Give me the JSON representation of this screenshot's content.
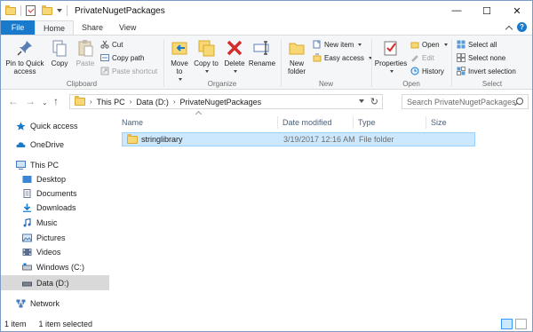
{
  "window": {
    "title": "PrivateNugetPackages",
    "controls": {
      "minimize": "—",
      "maximize": "☐",
      "close": "✕"
    }
  },
  "tabs": [
    "File",
    "Home",
    "Share",
    "View"
  ],
  "ribbon": {
    "clipboard": {
      "label": "Clipboard",
      "pin": "Pin to Quick access",
      "copy": "Copy",
      "paste": "Paste",
      "cut": "Cut",
      "copy_path": "Copy path",
      "paste_shortcut": "Paste shortcut"
    },
    "organize": {
      "label": "Organize",
      "move_to": "Move to",
      "copy_to": "Copy to",
      "delete": "Delete",
      "rename": "Rename"
    },
    "new": {
      "label": "New",
      "new_folder": "New folder",
      "new_item": "New item",
      "easy_access": "Easy access"
    },
    "open": {
      "label": "Open",
      "properties": "Properties",
      "open": "Open",
      "edit": "Edit",
      "history": "History"
    },
    "select": {
      "label": "Select",
      "select_all": "Select all",
      "select_none": "Select none",
      "invert": "Invert selection"
    }
  },
  "address": {
    "crumbs": [
      "This PC",
      "Data (D:)",
      "PrivateNugetPackages"
    ],
    "search_placeholder": "Search PrivateNugetPackages"
  },
  "nav": {
    "quick_access": "Quick access",
    "onedrive": "OneDrive",
    "this_pc": "This PC",
    "desktop": "Desktop",
    "documents": "Documents",
    "downloads": "Downloads",
    "music": "Music",
    "pictures": "Pictures",
    "videos": "Videos",
    "windows_c": "Windows (C:)",
    "data_d": "Data (D:)",
    "network": "Network"
  },
  "columns": {
    "name": "Name",
    "date": "Date modified",
    "type": "Type",
    "size": "Size"
  },
  "files": [
    {
      "name": "stringlibrary",
      "date": "3/19/2017 12:16 AM",
      "type": "File folder",
      "size": ""
    }
  ],
  "status": {
    "count": "1 item",
    "selected": "1 item selected"
  },
  "colors": {
    "accent": "#1979ca",
    "selection": "#cce8ff",
    "folder": "#f8d775"
  }
}
